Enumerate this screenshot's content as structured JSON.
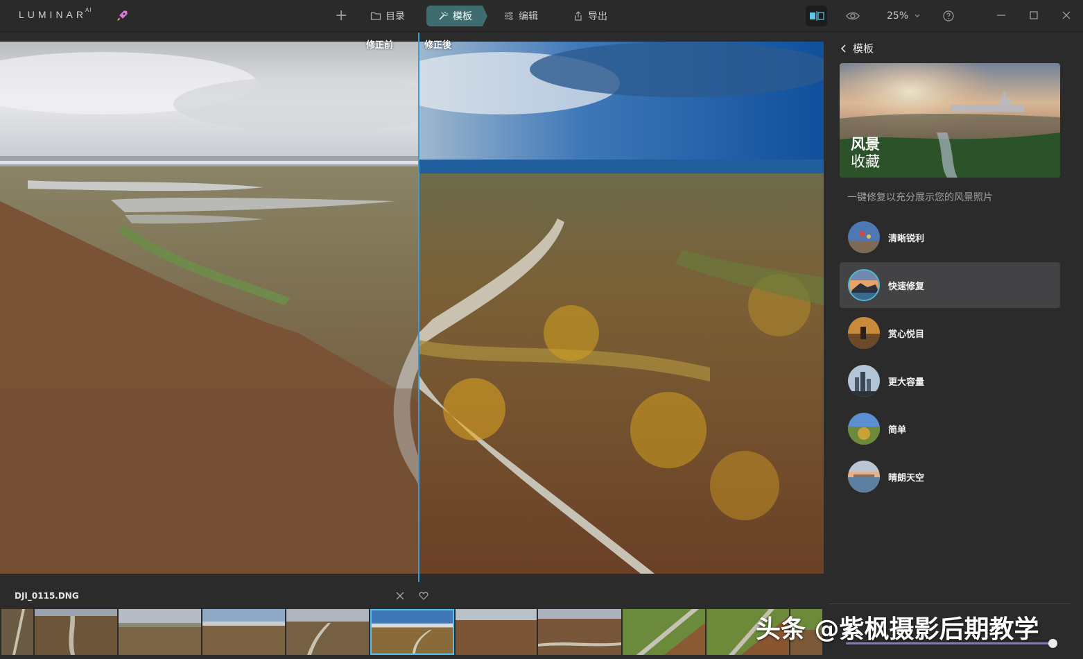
{
  "app": {
    "logo": "LUMINAR",
    "logo_sup": "AI"
  },
  "toolbar": {
    "nav": [
      {
        "label": "目录",
        "icon": "folder-icon"
      },
      {
        "label": "模板",
        "icon": "magic-wand-icon",
        "active": true
      },
      {
        "label": "编辑",
        "icon": "sliders-icon"
      },
      {
        "label": "导出",
        "icon": "share-icon"
      }
    ],
    "zoom": "25%"
  },
  "canvas": {
    "before_label": "修正前",
    "after_label": "修正後"
  },
  "panel": {
    "back_title": "模板",
    "hero_title": "风景",
    "hero_subtitle": "收藏",
    "description": "一键修复以充分展示您的风景照片",
    "presets": [
      {
        "name": "清晰锐利",
        "active": false
      },
      {
        "name": "快速修复",
        "active": true
      },
      {
        "name": "赏心悦目",
        "active": false
      },
      {
        "name": "更大容量",
        "active": false
      },
      {
        "name": "简单",
        "active": false
      },
      {
        "name": "晴朗天空",
        "active": false
      }
    ]
  },
  "filmstrip": {
    "filename": "DJI_0115.DNG",
    "selected_index": 5
  },
  "watermark": "头条 @紫枫摄影后期教学",
  "colors": {
    "accent": "#3e6c6f",
    "split": "#3a9bd8",
    "selection": "#55c0e6"
  }
}
